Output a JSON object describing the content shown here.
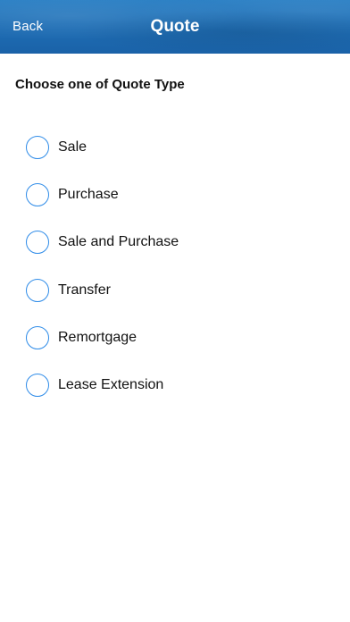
{
  "header": {
    "back_label": "Back",
    "title": "Quote",
    "background_color": "#1f6fb6"
  },
  "main": {
    "heading": "Choose one of Quote Type",
    "options": [
      {
        "label": "Sale",
        "selected": false
      },
      {
        "label": "Purchase",
        "selected": false
      },
      {
        "label": "Sale and Purchase",
        "selected": false
      },
      {
        "label": "Transfer",
        "selected": false
      },
      {
        "label": "Remortgage",
        "selected": false
      },
      {
        "label": "Lease Extension",
        "selected": false
      }
    ],
    "radio_color": "#2f8ce8"
  }
}
